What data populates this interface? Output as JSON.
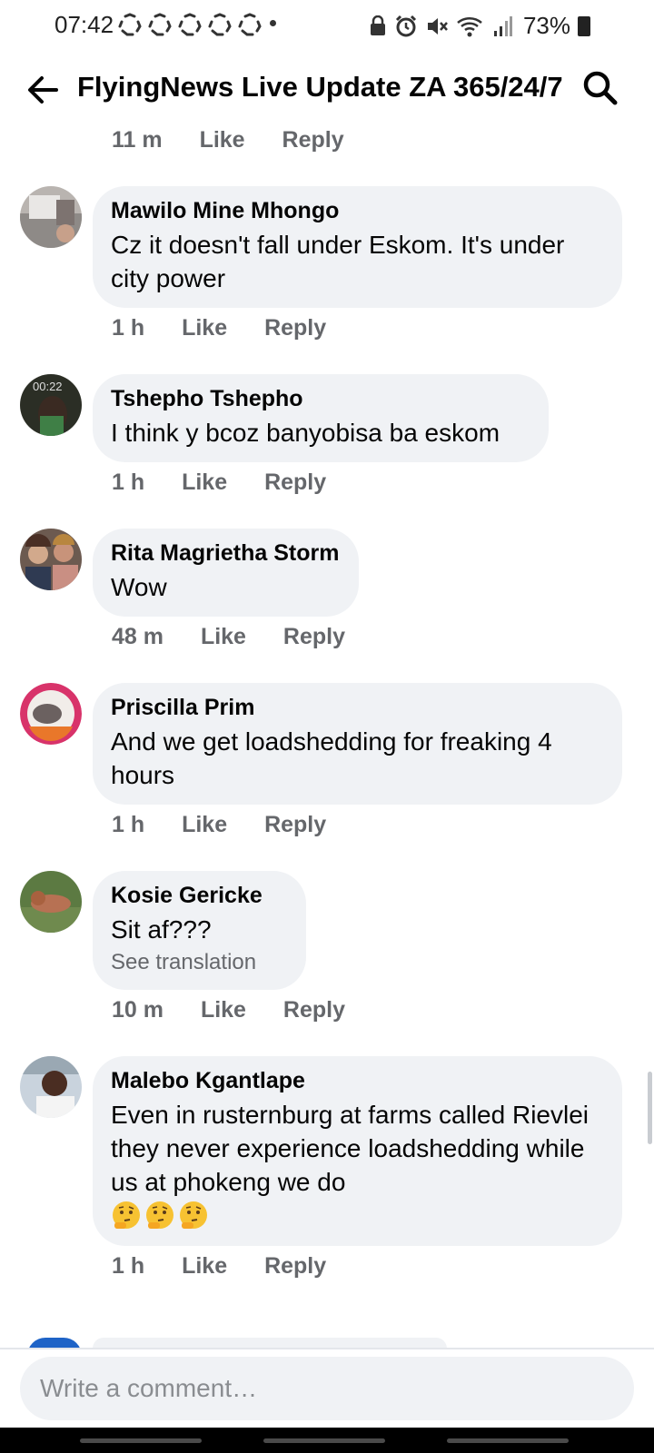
{
  "status_bar": {
    "time": "07:42",
    "battery": "73%",
    "icons": [
      "recycle-icon",
      "recycle-icon",
      "recycle-icon",
      "recycle-icon",
      "recycle-icon",
      "lock-icon",
      "alarm-icon",
      "mute-icon",
      "wifi-icon",
      "signal-icon",
      "battery-icon"
    ]
  },
  "header": {
    "title": "FlyingNews Live Update ZA 365/24/7",
    "back_icon": "arrow-left-icon",
    "search_icon": "search-icon"
  },
  "previous_actions": {
    "time": "11 m",
    "like": "Like",
    "reply": "Reply"
  },
  "comments": [
    {
      "author": "Mawilo Mine Mhongo",
      "text": "Cz it doesn't fall under Eskom. It's under city power",
      "time": "1 h",
      "like": "Like",
      "reply": "Reply"
    },
    {
      "author": "Tshepho Tshepho",
      "text": "I think y bcoz banyobisa ba eskom",
      "avatar_text": "00:22",
      "time": "1 h",
      "like": "Like",
      "reply": "Reply"
    },
    {
      "author": "Rita Magrietha Storm",
      "text": "Wow",
      "time": "48 m",
      "like": "Like",
      "reply": "Reply"
    },
    {
      "author": "Priscilla Prim",
      "text": "And we get loadshedding for freaking 4 hours",
      "time": "1 h",
      "like": "Like",
      "reply": "Reply"
    },
    {
      "author": "Kosie Gericke",
      "text": "Sit af???",
      "see_translation": "See translation",
      "time": "10 m",
      "like": "Like",
      "reply": "Reply"
    },
    {
      "author": "Malebo Kgantlape",
      "text": "Even in rusternburg at farms called Rievlei they never experience loadshedding while us at phokeng we do",
      "emojis": [
        "thinking-face-emoji",
        "thinking-face-emoji",
        "thinking-face-emoji"
      ],
      "time": "1 h",
      "like": "Like",
      "reply": "Reply"
    }
  ],
  "composer": {
    "placeholder": "Write a comment…"
  },
  "colors": {
    "bubble": "#f0f2f5",
    "meta_text": "#65676b",
    "text": "#050505"
  }
}
